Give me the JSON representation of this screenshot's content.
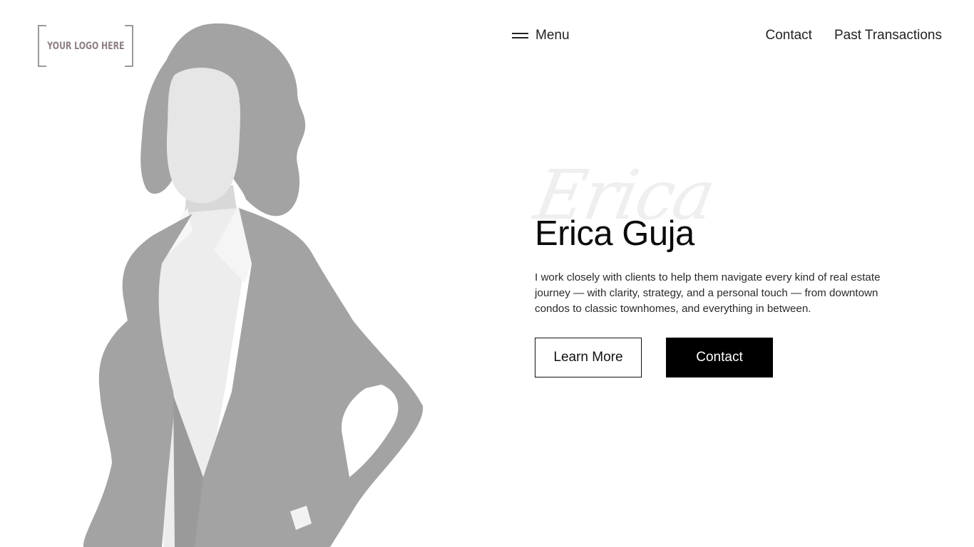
{
  "logo": {
    "text": "YOUR LOGO HERE"
  },
  "nav": {
    "menu_label": "Menu",
    "menu_icon": "hamburger-icon",
    "links": [
      {
        "label": "Contact"
      },
      {
        "label": "Past Transactions"
      }
    ]
  },
  "hero": {
    "script_name": "Erica",
    "title": "Erica Guja",
    "description": "I work closely with clients to help them navigate every kind of real estate journey — with clarity, strategy, and a personal touch — from downtown condos to classic townhomes, and everything in between.",
    "buttons": {
      "learn_more": "Learn More",
      "contact": "Contact"
    }
  },
  "colors": {
    "background": "#ffffff",
    "text": "#111111",
    "primary_button_bg": "#000000",
    "silhouette": "#a3a3a3"
  }
}
